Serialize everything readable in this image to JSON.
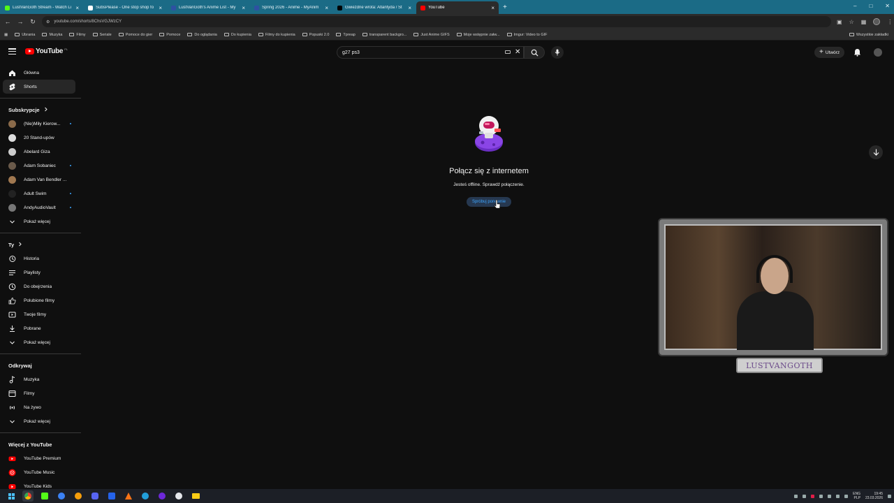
{
  "browser": {
    "tabs": [
      {
        "title": "LustVanGoth Stream - Watch Li",
        "color": "#53fc18"
      },
      {
        "title": "SubsPlease - One stop shop fo",
        "color": "#ffffff"
      },
      {
        "title": "LustVanGoth's Anime List - My",
        "color": "#2e51a2"
      },
      {
        "title": "Spring 2026 - Anime - MyAnim",
        "color": "#2e51a2"
      },
      {
        "title": "Gwiezdne wrota: Atlantyda / St",
        "color": "#000000"
      },
      {
        "title": "YouTube",
        "color": "#ff0000"
      }
    ],
    "active_tab_index": 5,
    "url": "youtube.com/shorts/8ChsVGJWzCY",
    "bookmarks": [
      "Ubrania",
      "Muzyka",
      "Filmy",
      "Seriale",
      "Pomoce do gier",
      "Pomoce",
      "Do oglądania",
      "Do kupienia",
      "Filmy do kupienia",
      "Popuski 2.0",
      "Tpreap",
      "transparent backgro...",
      "Just Anime GIFS",
      "Moje wstępnie załw...",
      "Imgur: Video to GIF"
    ],
    "bookmarks_all": "Wszystkie zakładki"
  },
  "header": {
    "logo_text": "YouTube",
    "country_code": "PL",
    "search_query": "g27 ps3",
    "create_label": "Utwórz"
  },
  "sidebar": {
    "main": [
      {
        "label": "Główna",
        "icon": "home-icon"
      },
      {
        "label": "Shorts",
        "icon": "shorts-icon"
      }
    ],
    "subs_heading": "Subskrypcje",
    "subscriptions": [
      {
        "name": "(Nie)Miły Kierow...",
        "color": "#8a6a4a",
        "live": true
      },
      {
        "name": "20 Stand-upów",
        "color": "#dddddd",
        "live": false
      },
      {
        "name": "Abelard Giza",
        "color": "#cccccc",
        "live": false
      },
      {
        "name": "Adam Sobaniec",
        "color": "#6a5a4a",
        "live": true
      },
      {
        "name": "Adam Van Bendler ...",
        "color": "#a07850",
        "live": false
      },
      {
        "name": "Adult Swim",
        "color": "#222222",
        "live": true
      },
      {
        "name": "AndyAudioVault",
        "color": "#777777",
        "live": true
      }
    ],
    "subs_more": "Pokaż więcej",
    "you_heading": "Ty",
    "you": [
      {
        "label": "Historia",
        "icon": "history-icon"
      },
      {
        "label": "Playlisty",
        "icon": "playlist-icon"
      },
      {
        "label": "Do obejrzenia",
        "icon": "watch-later-icon"
      },
      {
        "label": "Polubione filmy",
        "icon": "like-icon"
      },
      {
        "label": "Twoje filmy",
        "icon": "your-videos-icon"
      },
      {
        "label": "Pobrane",
        "icon": "download-icon"
      }
    ],
    "you_more": "Pokaż więcej",
    "explore_heading": "Odkrywaj",
    "explore": [
      {
        "label": "Muzyka",
        "icon": "music-icon"
      },
      {
        "label": "Filmy",
        "icon": "movies-icon"
      },
      {
        "label": "Na żywo",
        "icon": "live-icon"
      }
    ],
    "explore_more": "Pokaż więcej",
    "more_heading": "Więcej z YouTube",
    "more": [
      {
        "label": "YouTube Premium",
        "icon": "youtube-premium-icon"
      },
      {
        "label": "YouTube Music",
        "icon": "youtube-music-icon"
      },
      {
        "label": "YouTube Kids",
        "icon": "youtube-kids-icon"
      }
    ]
  },
  "offline": {
    "title": "Połącz się z internetem",
    "subtitle": "Jesteś offline. Sprawdź połączenie.",
    "retry_label": "Spróbuj ponownie"
  },
  "webcam": {
    "nameplate": "LUSTVANGOTH"
  },
  "taskbar": {
    "language": "ENG",
    "layout": "PLP",
    "time": "19:45",
    "date": "23.03.2026"
  }
}
